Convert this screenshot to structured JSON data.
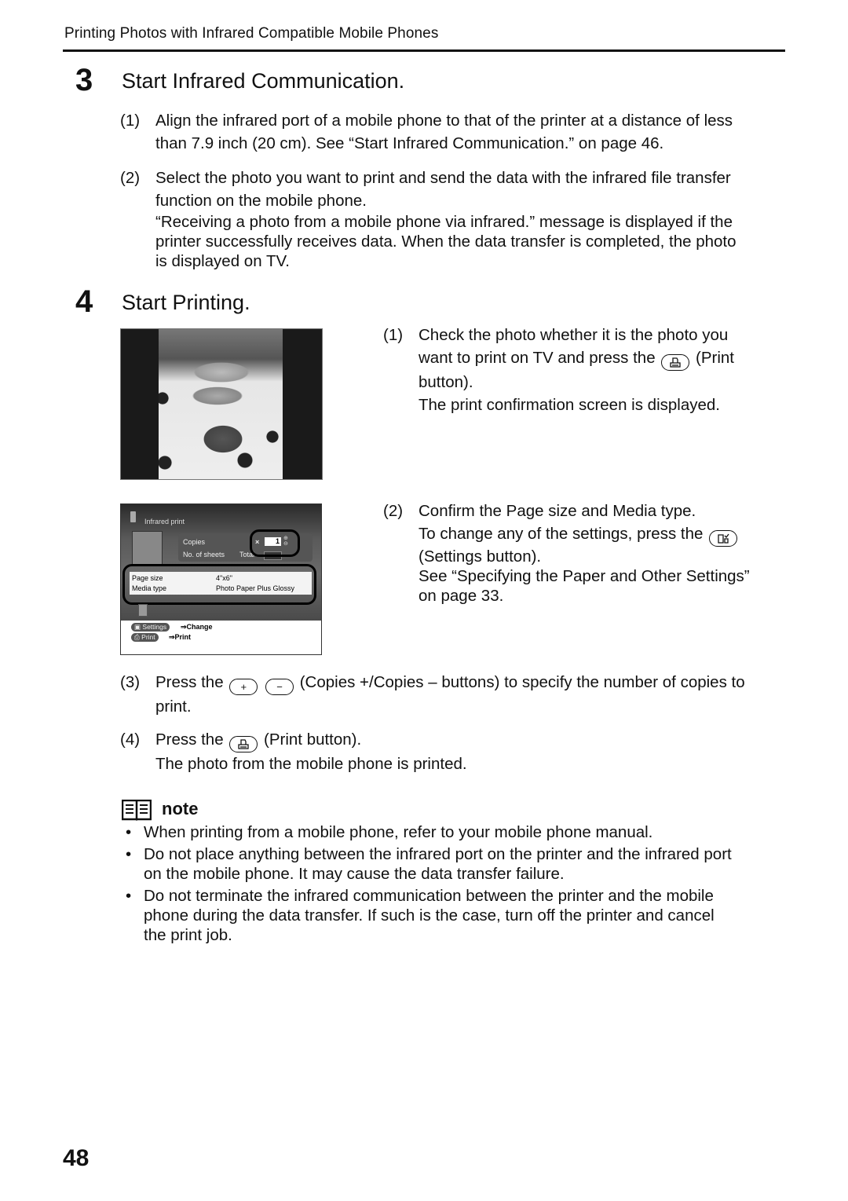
{
  "header": {
    "title": "Printing Photos with Infrared Compatible Mobile Phones"
  },
  "steps": [
    {
      "number": "3",
      "title": "Start Infrared Communication.",
      "items": [
        {
          "num": "(1)",
          "lines": [
            "Align the infrared port of a mobile phone to that of the printer at a distance of less",
            "than 7.9 inch (20 cm). See “Start Infrared Communication.” on page 46."
          ]
        },
        {
          "num": "(2)",
          "lines": [
            "Select the photo you want to print and send the data with the infrared file transfer",
            "function on the mobile phone."
          ],
          "continuation": [
            "“Receiving a photo from a mobile phone via infrared.” message is displayed if the",
            "printer successfully receives data. When the data transfer is completed, the photo",
            "is displayed on TV."
          ]
        }
      ]
    },
    {
      "number": "4",
      "title": "Start Printing.",
      "items": [
        {
          "num": "(1)",
          "line1": "Check the photo whether it is the photo you",
          "line2_pre": "want to print on TV and press the",
          "line2_post": "(Print",
          "line3": "button).",
          "line4": "The print confirmation screen is displayed.",
          "button_icon": "print-icon"
        },
        {
          "num": "(2)",
          "line1": "Confirm the Page size and Media type.",
          "line2_pre": "To change any of the settings, press the",
          "line3": "(Settings button).",
          "line4": "See “Specifying the Paper and Other Settings”",
          "line5": "on page 33.",
          "button_icon": "settings-icon"
        },
        {
          "num": "(3)",
          "pre": "Press the",
          "plus": "+",
          "minus": "−",
          "post": "(Copies +/Copies – buttons) to specify the number of copies to",
          "line2": "print."
        },
        {
          "num": "(4)",
          "pre": "Press the",
          "post": "(Print button).",
          "line2": "The photo from the mobile phone is printed."
        }
      ]
    }
  ],
  "screen": {
    "title": "Infrared print",
    "copies_label": "Copies",
    "sheets_label": "No. of sheets",
    "total_label": "Total",
    "copies_prefix": "×",
    "copies_value": "1",
    "page_size_label": "Page size",
    "page_size_value": "4\"x6\"",
    "media_type_label": "Media type",
    "media_type_value": "Photo Paper Plus Glossy",
    "settings_pill": "Settings",
    "settings_action": "⇒Change",
    "print_pill": "Print",
    "print_action": "⇒Print"
  },
  "note": {
    "label": "note",
    "bullets": [
      [
        "When printing from a mobile phone, refer to your mobile phone manual."
      ],
      [
        "Do not place anything between the infrared port on the printer and the infrared port",
        "on the mobile phone. It may cause the data transfer failure."
      ],
      [
        "Do not terminate the infrared communication between the printer and the mobile",
        "phone during the data transfer. If such is the case, turn off the printer and cancel",
        "the print job."
      ]
    ]
  },
  "page_number": "48"
}
